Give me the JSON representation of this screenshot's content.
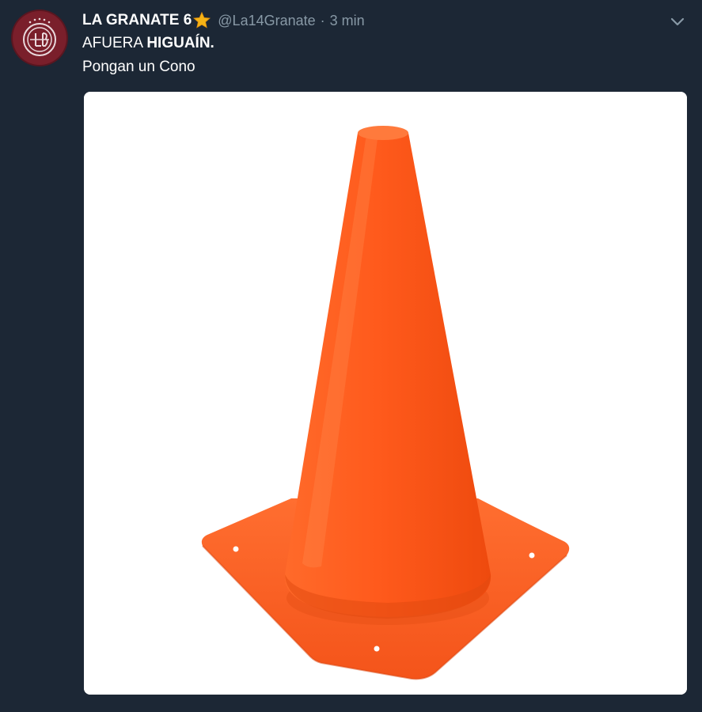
{
  "tweet": {
    "display_name": "LA GRANATE 6",
    "badge_icon": "star-icon",
    "handle": "@La14Granate",
    "separator": "·",
    "time": "3 min",
    "line1_prefix": "AFUERA ",
    "line1_bold": "HIGUAÍN.",
    "line2": "Pongan un Cono",
    "media_subject": "orange traffic cone",
    "menu_icon": "chevron-down-icon"
  },
  "colors": {
    "background": "#1c2735",
    "secondary_text": "#8899a6",
    "cone": "#ff5a1f",
    "avatar": "#7a1f2b",
    "star": "#f5b316"
  }
}
